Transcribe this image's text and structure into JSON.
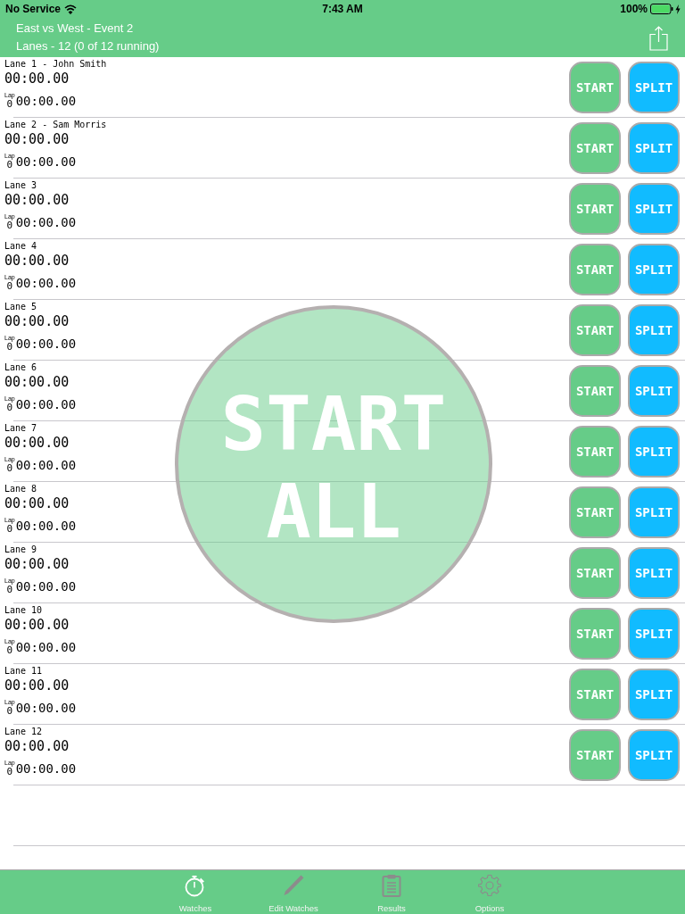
{
  "status_bar": {
    "carrier": "No Service",
    "time": "7:43 AM",
    "battery": "100%"
  },
  "header": {
    "title": "East vs West - Event 2",
    "subtitle": "Lanes - 12 (0 of 12 running)"
  },
  "lanes": [
    {
      "label": "Lane 1 - John Smith",
      "time": "00:00.00",
      "lap_label": "Lap",
      "lap_count": "0",
      "lap_time": "00:00.00",
      "buttons": [
        {
          "kind": "start",
          "label": "START"
        },
        {
          "kind": "split",
          "label": "SPLIT"
        }
      ]
    },
    {
      "label": "Lane 2 - Sam Morris",
      "time": "00:00.00",
      "lap_label": "Lap",
      "lap_count": "0",
      "lap_time": "00:00.00",
      "buttons": [
        {
          "kind": "start",
          "label": "START"
        },
        {
          "kind": "split",
          "label": "SPLIT"
        }
      ]
    },
    {
      "label": "Lane 3",
      "time": "00:00.00",
      "lap_label": "Lap",
      "lap_count": "0",
      "lap_time": "00:00.00",
      "buttons": [
        {
          "kind": "start",
          "label": "START"
        },
        {
          "kind": "split",
          "label": "SPLIT"
        }
      ]
    },
    {
      "label": "Lane 4",
      "time": "00:00.00",
      "lap_label": "Lap",
      "lap_count": "0",
      "lap_time": "00:00.00",
      "buttons": [
        {
          "kind": "start",
          "label": "START"
        },
        {
          "kind": "split",
          "label": "SPLIT"
        }
      ]
    },
    {
      "label": "Lane 5",
      "time": "00:00.00",
      "lap_label": "Lap",
      "lap_count": "0",
      "lap_time": "00:00.00",
      "buttons": [
        {
          "kind": "start",
          "label": "START"
        },
        {
          "kind": "split",
          "label": "SPLIT"
        }
      ]
    },
    {
      "label": "Lane 6",
      "time": "00:00.00",
      "lap_label": "Lap",
      "lap_count": "0",
      "lap_time": "00:00.00",
      "buttons": [
        {
          "kind": "start",
          "label": "START"
        },
        {
          "kind": "split",
          "label": "SPLIT"
        }
      ]
    },
    {
      "label": "Lane 7",
      "time": "00:00.00",
      "lap_label": "Lap",
      "lap_count": "0",
      "lap_time": "00:00.00",
      "buttons": [
        {
          "kind": "start",
          "label": "START"
        },
        {
          "kind": "split",
          "label": "SPLIT"
        }
      ]
    },
    {
      "label": "Lane 8",
      "time": "00:00.00",
      "lap_label": "Lap",
      "lap_count": "0",
      "lap_time": "00:00.00",
      "buttons": [
        {
          "kind": "start",
          "label": "START"
        },
        {
          "kind": "split",
          "label": "SPLIT"
        }
      ]
    },
    {
      "label": "Lane 9",
      "time": "00:00.00",
      "lap_label": "Lap",
      "lap_count": "0",
      "lap_time": "00:00.00",
      "buttons": [
        {
          "kind": "start",
          "label": "START"
        },
        {
          "kind": "split",
          "label": "SPLIT"
        }
      ]
    },
    {
      "label": "Lane 10",
      "time": "00:00.00",
      "lap_label": "Lap",
      "lap_count": "0",
      "lap_time": "00:00.00",
      "buttons": [
        {
          "kind": "start",
          "label": "START"
        },
        {
          "kind": "split",
          "label": "SPLIT"
        }
      ]
    },
    {
      "label": "Lane 11",
      "time": "00:00.00",
      "lap_label": "Lap",
      "lap_count": "0",
      "lap_time": "00:00.00",
      "buttons": [
        {
          "kind": "start",
          "label": "START"
        },
        {
          "kind": "split",
          "label": "SPLIT"
        }
      ]
    },
    {
      "label": "Lane 12",
      "time": "00:00.00",
      "lap_label": "Lap",
      "lap_count": "0",
      "lap_time": "00:00.00",
      "buttons": [
        {
          "kind": "start",
          "label": "START"
        },
        {
          "kind": "split",
          "label": "SPLIT"
        }
      ]
    }
  ],
  "start_all": {
    "label": "START ALL"
  },
  "tabs": [
    {
      "kind": "stopwatch",
      "label": "Watches",
      "selected": true
    },
    {
      "kind": "pencil",
      "label": "Edit Watches",
      "selected": false
    },
    {
      "kind": "clipboard",
      "label": "Results",
      "selected": false
    },
    {
      "kind": "gear",
      "label": "Options",
      "selected": false
    }
  ]
}
